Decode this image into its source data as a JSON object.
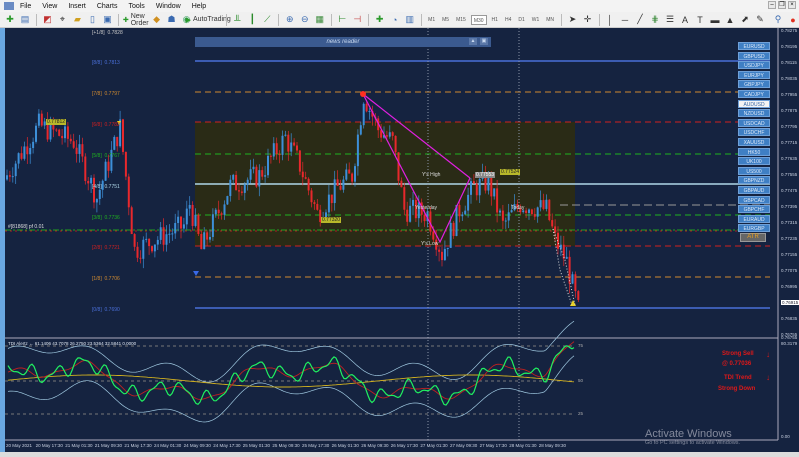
{
  "menu": [
    "File",
    "View",
    "Insert",
    "Charts",
    "Tools",
    "Window",
    "Help"
  ],
  "toolbar": {
    "new_order": "New Order",
    "autotrading": "AutoTrading",
    "timeframes": [
      "M1",
      "M5",
      "M15",
      "M30",
      "H1",
      "H4",
      "D1",
      "W1",
      "MN"
    ],
    "active_timeframe": "M30"
  },
  "news_reader": {
    "title": "news reader"
  },
  "fib_levels": [
    {
      "label": "[+1/8]",
      "value": "0.7828",
      "color": "#c8c8c8"
    },
    {
      "label": "[8/8]",
      "value": "0.7813",
      "color": "#4a6fd8"
    },
    {
      "label": "[7/8]",
      "value": "0.7797",
      "color": "#d08a30"
    },
    {
      "label": "[6/8]",
      "value": "0.7782",
      "color": "#d02020"
    },
    {
      "label": "[5/8]",
      "value": "0.7767",
      "color": "#20b020"
    },
    {
      "label": "[4/8]",
      "value": "0.7751",
      "color": "#b0d8e8"
    },
    {
      "label": "[3/8]",
      "value": "0.7736",
      "color": "#20b020"
    },
    {
      "label": "[2/8]",
      "value": "0.7721",
      "color": "#d02020"
    },
    {
      "label": "[1/8]",
      "value": "0.7706",
      "color": "#d08a30"
    },
    {
      "label": "[0/8]",
      "value": "0.7690",
      "color": "#4a6fd8"
    }
  ],
  "order_line_label": "#[81868] pf 0.01",
  "chart_labels": {
    "ys_high": "Y's High",
    "ys_low": "Y's Low",
    "yesterday": "Yesterday",
    "today": "Today"
  },
  "price_tags": {
    "left_high": "0.77812",
    "mid_low": "0.77320",
    "y_high": "0.77553",
    "right": "0.77524"
  },
  "symbols": [
    "EURUSD",
    "GBPUSD",
    "USDJPY",
    "EURJPY",
    "GBPJPY",
    "CADJPY",
    "AUDUSD",
    "NZDUSD",
    "USDCAD",
    "USDCHF",
    "XAUUSD",
    "HK50",
    "UK100",
    "US500",
    "GBPNZD",
    "GBPAUD",
    "GBPCAD",
    "GBPCHF",
    "EURAUD",
    "EURGBP"
  ],
  "selected_symbol": "AUDUSD",
  "atr_button": "ATR",
  "price_axis": [
    "0.78275",
    "0.78195",
    "0.78115",
    "0.78035",
    "0.77955",
    "0.77875",
    "0.77795",
    "0.77715",
    "0.77635",
    "0.77555",
    "0.77475",
    "0.77395",
    "0.77315",
    "0.77235",
    "0.77155",
    "0.77075",
    "0.76995",
    "0.76915",
    "0.76835",
    "0.76755"
  ],
  "current_price": "0.76915",
  "indicator": {
    "title": "TDI Alertz ← 61.1406 43.7078 26.2750 23.5364 32.5841 0.0000",
    "levels": [
      "75",
      "50",
      "25"
    ],
    "axis_top": "80.3179",
    "axis_bottom": "0.00",
    "axis_top_price": "0.76755"
  },
  "signals": {
    "line1": "Strong Sell",
    "line2": "@ 0.77036",
    "line3": "TDI Trend",
    "line4": "Strong Down"
  },
  "time_axis": [
    "20 May 2021",
    "20 May 17:30",
    "21 May 01:30",
    "21 May 09:30",
    "21 May 17:30",
    "24 May 01:30",
    "24 May 09:30",
    "24 May 17:30",
    "25 May 01:30",
    "25 May 09:30",
    "25 May 17:30",
    "26 May 01:30",
    "26 May 09:30",
    "26 May 17:30",
    "27 May 01:30",
    "27 May 09:30",
    "27 May 17:30",
    "28 May 01:30",
    "28 May 09:30"
  ],
  "watermark": {
    "title": "Activate Windows",
    "subtitle": "Go to PC settings to activate Windows."
  },
  "chart_data": {
    "type": "candlestick",
    "symbol": "AUDUSD",
    "timeframe": "M30",
    "ylim": [
      0.7675,
      0.783
    ],
    "price_path": [
      [
        0,
        0.7755
      ],
      [
        12,
        0.7782
      ],
      [
        24,
        0.7774
      ],
      [
        32,
        0.7746
      ],
      [
        40,
        0.7781
      ],
      [
        45,
        0.772
      ],
      [
        62,
        0.7732
      ],
      [
        64,
        0.7743
      ],
      [
        68,
        0.772
      ],
      [
        78,
        0.7752
      ],
      [
        88,
        0.7757
      ],
      [
        97,
        0.7776
      ],
      [
        102,
        0.7762
      ],
      [
        108,
        0.7738
      ],
      [
        115,
        0.7751
      ],
      [
        120,
        0.7757
      ],
      [
        124,
        0.7797
      ],
      [
        129,
        0.778
      ],
      [
        134,
        0.7774
      ],
      [
        138,
        0.774
      ],
      [
        146,
        0.7738
      ],
      [
        151,
        0.7718
      ],
      [
        157,
        0.774
      ],
      [
        162,
        0.7751
      ],
      [
        167,
        0.7754
      ],
      [
        172,
        0.7732
      ],
      [
        178,
        0.7743
      ],
      [
        187,
        0.774
      ],
      [
        190,
        0.7725
      ],
      [
        194,
        0.7714
      ],
      [
        198,
        0.769
      ]
    ],
    "colors": {
      "up": "#3d8fd8",
      "down": "#e8282c"
    }
  }
}
